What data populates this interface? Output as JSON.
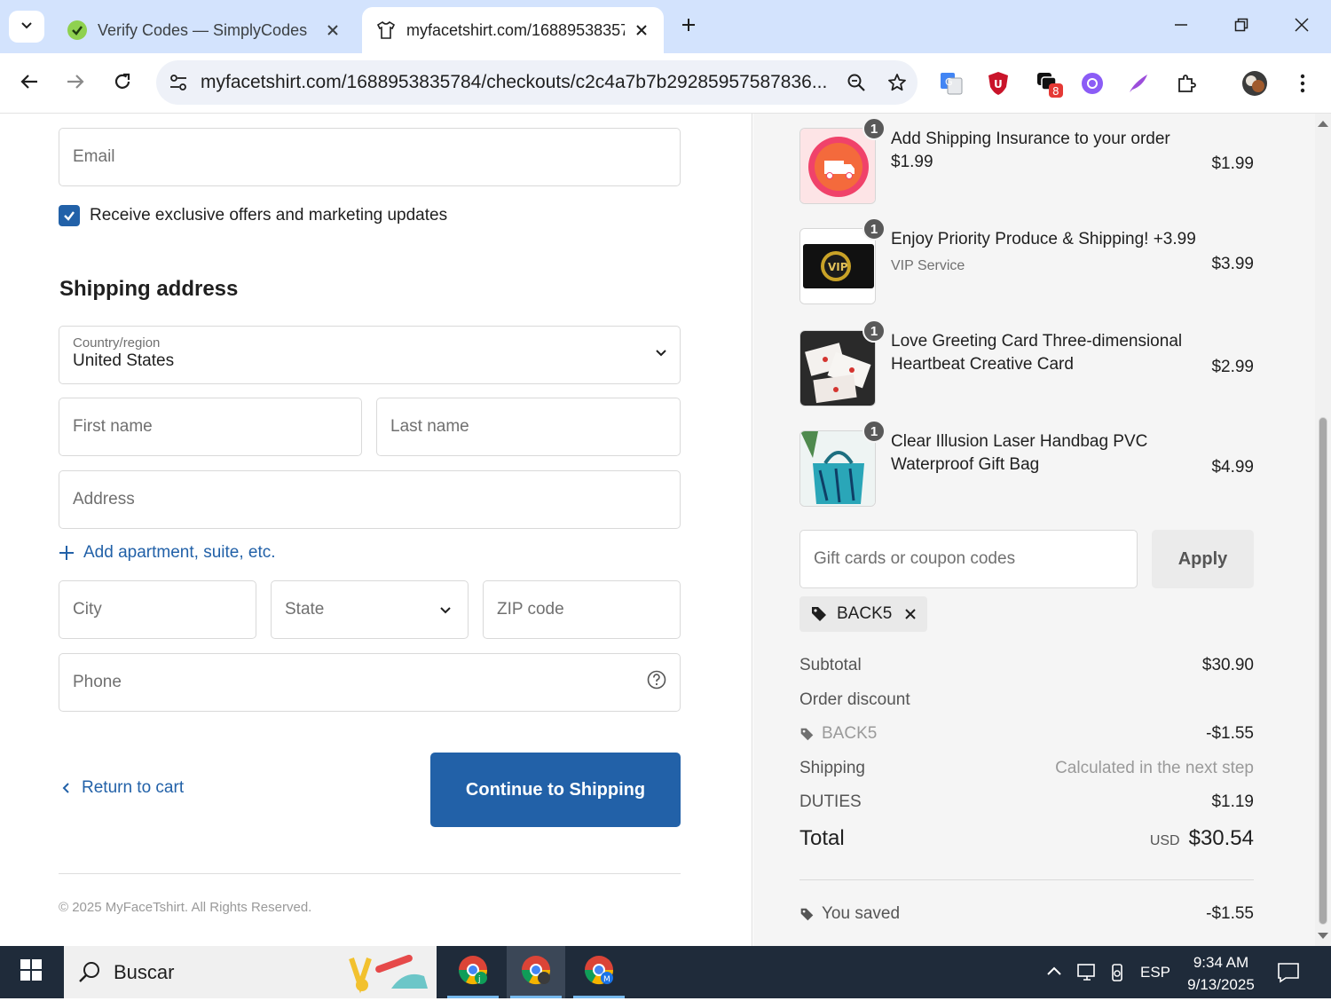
{
  "browser": {
    "tabs": [
      {
        "title": "Verify Codes — SimplyCodes",
        "active": false
      },
      {
        "title": "myfacetshirt.com/16889538357",
        "active": true
      }
    ],
    "url": "myfacetshirt.com/1688953835784/checkouts/c2c4a7b7b29285957587836...",
    "extensions": {
      "notification_badge": "8"
    }
  },
  "contact": {
    "email_placeholder": "Email",
    "marketing_optin_label": "Receive exclusive offers and marketing updates",
    "marketing_optin_checked": true
  },
  "shipping": {
    "title": "Shipping address",
    "country_label": "Country/region",
    "country_value": "United States",
    "first_name_placeholder": "First name",
    "last_name_placeholder": "Last name",
    "address_placeholder": "Address",
    "add_apartment_label": "Add apartment, suite, etc.",
    "city_placeholder": "City",
    "state_placeholder": "State",
    "zip_placeholder": "ZIP code",
    "phone_placeholder": "Phone"
  },
  "actions": {
    "return_label": "Return to cart",
    "continue_label": "Continue to Shipping"
  },
  "footer": {
    "copyright": "© 2025 MyFaceTshirt. All Rights Reserved."
  },
  "order": {
    "items": [
      {
        "qty": "1",
        "name": "Add Shipping Insurance to your order",
        "sub": "$1.99",
        "price": "$1.99",
        "icon": "shipping-insurance-badge-icon"
      },
      {
        "qty": "1",
        "name": "Enjoy Priority Produce & Shipping! +3.99",
        "sub": "VIP Service",
        "price": "$3.99",
        "icon": "vip-badge-icon"
      },
      {
        "qty": "1",
        "name": "Love Greeting Card Three-dimensional Heartbeat Creative Card",
        "sub": "",
        "price": "$2.99",
        "icon": "greeting-card-image"
      },
      {
        "qty": "1",
        "name": "Clear Illusion Laser Handbag PVC Waterproof Gift Bag",
        "sub": "",
        "price": "$4.99",
        "icon": "handbag-image"
      }
    ],
    "coupon_placeholder": "Gift cards or coupon codes",
    "apply_label": "Apply",
    "applied_code": "BACK5",
    "subtotal_label": "Subtotal",
    "subtotal_value": "$30.90",
    "discount_label": "Order discount",
    "discount_code": "BACK5",
    "discount_value": "-$1.55",
    "shipping_label": "Shipping",
    "shipping_value": "Calculated in the next step",
    "duties_label": "DUTIES",
    "duties_value": "$1.19",
    "total_label": "Total",
    "total_currency": "USD",
    "total_value": "$30.54",
    "saved_label": "You saved",
    "saved_value": "-$1.55"
  },
  "taskbar": {
    "search_placeholder": "Buscar",
    "language": "ESP",
    "time": "9:34 AM",
    "date": "9/13/2025"
  },
  "colors": {
    "accent": "#2261a8",
    "tabstrip": "#d3e3fd",
    "summary_bg": "#f5f5f5",
    "taskbar": "#1f2b3a"
  }
}
